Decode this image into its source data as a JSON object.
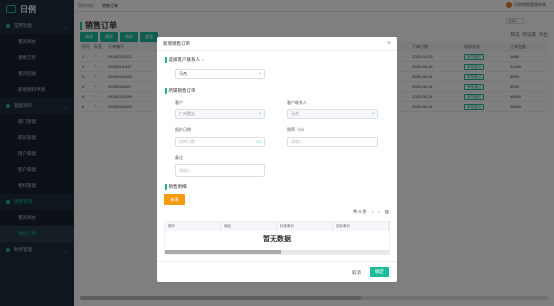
{
  "app": {
    "logo_text": "日例"
  },
  "sidebar": {
    "items": [
      {
        "label": "常用功能",
        "type": "group"
      },
      {
        "label": "我的待办",
        "type": "sub"
      },
      {
        "label": "销售订单",
        "type": "sub"
      },
      {
        "label": "我的回收",
        "type": "sub"
      },
      {
        "label": "新增物料申请",
        "type": "sub"
      },
      {
        "label": "基础资料",
        "type": "group"
      },
      {
        "label": "部门管理",
        "type": "sub"
      },
      {
        "label": "职员管理",
        "type": "sub"
      },
      {
        "label": "用户管理",
        "type": "sub"
      },
      {
        "label": "客户管理",
        "type": "sub"
      },
      {
        "label": "物料管理",
        "type": "sub"
      },
      {
        "label": "销售管理",
        "type": "group-open"
      },
      {
        "label": "我的待办",
        "type": "sub"
      },
      {
        "label": "销售订单",
        "type": "sub-active"
      },
      {
        "label": "财务管理",
        "type": "group"
      }
    ]
  },
  "topbar": {
    "tabs": [
      "我的待办",
      "销售订单"
    ],
    "user": "日例销售管理系统",
    "search_placeholder": "请输入"
  },
  "page": {
    "title": "销售订单",
    "toolbar": [
      "新增",
      "删除",
      "审核",
      "查看"
    ],
    "tools": [
      "筛选",
      "列设置",
      "导出"
    ]
  },
  "grid": {
    "headers": [
      "序号",
      "标签",
      "订单编号",
      "下单日期",
      "审核状态",
      "订单金额"
    ],
    "rows": [
      {
        "no": "1",
        "code": "SO00202201",
        "date": "2020-05-20",
        "status": "审核通过",
        "amount": "1666"
      },
      {
        "no": "2",
        "code": "SO00201547",
        "date": "2020-05-19",
        "status": "审核通过",
        "amount": "21000"
      },
      {
        "no": "3",
        "code": "SO00201528",
        "date": "2020-05-14",
        "status": "审核通过",
        "amount": "3000"
      },
      {
        "no": "4",
        "code": "SO00201527",
        "date": "2020-05-14",
        "status": "审核通过",
        "amount": "4000"
      },
      {
        "no": "5",
        "code": "SO00201526",
        "date": "2020-05-14",
        "status": "审核通过",
        "amount": "40000"
      },
      {
        "no": "6",
        "code": "SO00201525",
        "date": "2020-05-14",
        "status": "审核通过",
        "amount": "25000"
      }
    ]
  },
  "modal": {
    "title": "新增销售订单",
    "section1": "选择客户联系人",
    "contact_value": "马杰",
    "section2": "所属销售订单",
    "customer_label": "客户",
    "customer_value": "广州置业",
    "contact_person_label": "客户联系人",
    "contact_person_value": "马杰",
    "date_label": "报价日期",
    "date_placeholder": "选择日期",
    "discount_label": "税率（%）",
    "discount_placeholder": "请输入",
    "remark_label": "备注",
    "remark_placeholder": "请输入",
    "section3": "销售明细",
    "add_button": "新增",
    "pager": "共 0 条",
    "detail_headers": [
      "操作",
      "商品",
      "标准单价",
      "实际单价"
    ],
    "no_data": "暂无数据",
    "cancel": "取消",
    "confirm": "确定"
  }
}
